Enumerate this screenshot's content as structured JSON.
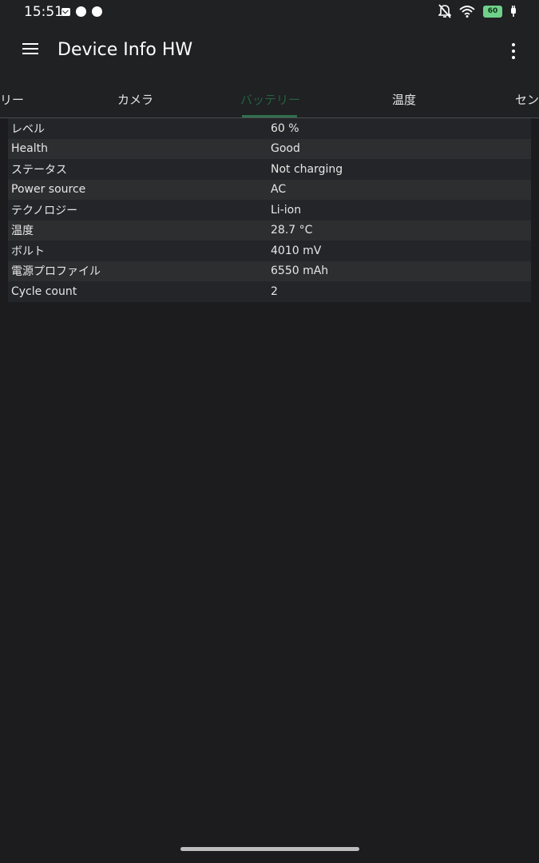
{
  "status_bar": {
    "time": "15:51",
    "battery_level": "60"
  },
  "app_bar": {
    "title": "Device Info HW"
  },
  "tabs": [
    {
      "label": "リー",
      "active": false
    },
    {
      "label": "カメラ",
      "active": false
    },
    {
      "label": "バッテリー",
      "active": true
    },
    {
      "label": "温度",
      "active": false
    },
    {
      "label": "セン",
      "active": false
    }
  ],
  "battery_table": [
    {
      "label": "レベル",
      "value": "60 %"
    },
    {
      "label": "Health",
      "value": "Good"
    },
    {
      "label": "ステータス",
      "value": "Not charging"
    },
    {
      "label": "Power source",
      "value": "AC"
    },
    {
      "label": "テクノロジー",
      "value": "Li-ion"
    },
    {
      "label": "温度",
      "value": "28.7 °C"
    },
    {
      "label": "ボルト",
      "value": "4010 mV"
    },
    {
      "label": "電源プロファイル",
      "value": "6550 mAh"
    },
    {
      "label": "Cycle count",
      "value": "2"
    }
  ],
  "colors": {
    "background": "#1c1c1f",
    "app_bar": "#1f2123",
    "accent": "#2f6f4e",
    "battery": "#6fd089"
  }
}
